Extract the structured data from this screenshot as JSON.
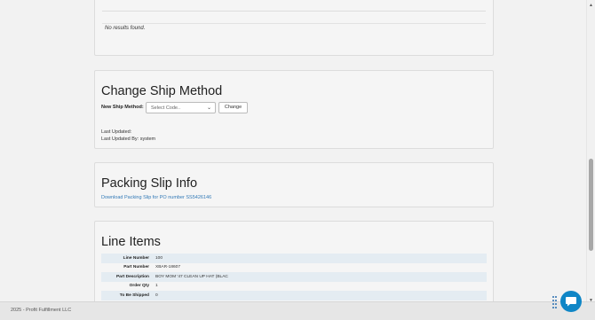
{
  "results_section": {
    "empty_text": "No results found."
  },
  "ship_method": {
    "title": "Change Ship Method",
    "field_label": "New Ship Method:",
    "select_placeholder": "Select Code..",
    "change_button": "Change",
    "last_updated": "Last Updated:",
    "last_updated_by": "Last Updated By: system"
  },
  "packing_slip": {
    "title": "Packing Slip Info",
    "link_text": "Download Packing Slip for PO number SS5426146"
  },
  "line_items": {
    "title": "Line Items",
    "rows": [
      {
        "label": "Line Number",
        "value": "100"
      },
      {
        "label": "Part Number",
        "value": "XBAR-18607"
      },
      {
        "label": "Part Description",
        "value": "BOY MOM '47 CLEAN UP HAT (BLAC"
      },
      {
        "label": "Order Qty",
        "value": "1"
      },
      {
        "label": "To Be Shipped",
        "value": "0"
      }
    ]
  },
  "footer": {
    "copyright": "2025 - Profit Fulfillment LLC"
  },
  "icons": {
    "chat": "chat-bubble-icon",
    "scroll_up": "arrow-up-icon",
    "scroll_down": "arrow-down-icon",
    "drag": "drag-dots-icon"
  },
  "colors": {
    "link": "#337ab7",
    "chat": "#0f86c6",
    "row_stripe": "#e4ecf2"
  }
}
